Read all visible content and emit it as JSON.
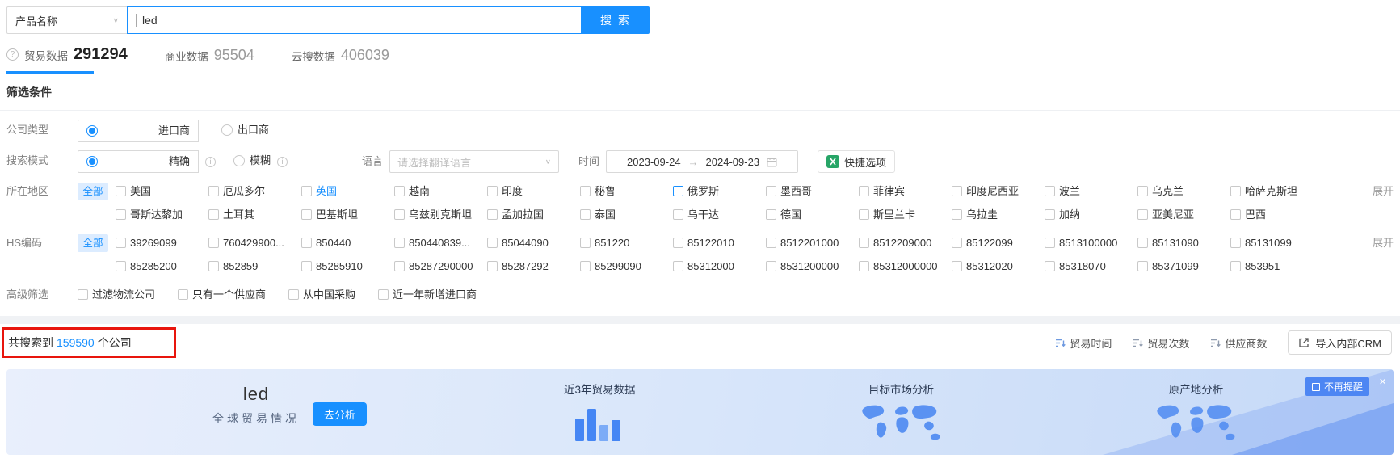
{
  "icons": {
    "chevron_down": "∨",
    "question_mark": "?",
    "info_mark": "i",
    "close": "×",
    "range_arrow": "→"
  },
  "search_bar": {
    "category": "产品名称",
    "query": "led",
    "button": "搜 索"
  },
  "tabs": {
    "trade": {
      "label": "贸易数据",
      "count": "291294"
    },
    "business": {
      "label": "商业数据",
      "count": "95504"
    },
    "cloud": {
      "label": "云搜数据",
      "count": "406039"
    }
  },
  "filters": {
    "title": "筛选条件",
    "company_type": {
      "label": "公司类型",
      "importer": "进口商",
      "exporter": "出口商",
      "selected": "进口商"
    },
    "search_mode": {
      "label": "搜索模式",
      "exact": "精确",
      "fuzzy": "模糊",
      "selected": "精确"
    },
    "language": {
      "label": "语言",
      "placeholder": "请选择翻译语言"
    },
    "time": {
      "label": "时间",
      "start": "2023-09-24",
      "end": "2024-09-23"
    },
    "quick_option": "快捷选项",
    "region": {
      "label": "所在地区",
      "all": "全部",
      "expand": "展开",
      "row1": [
        "美国",
        "厄瓜多尔",
        "英国",
        "越南",
        "印度",
        "秘鲁",
        "俄罗斯",
        "墨西哥",
        "菲律宾",
        "印度尼西亚",
        "波兰",
        "乌克兰",
        "哈萨克斯坦"
      ],
      "row2": [
        "哥斯达黎加",
        "土耳其",
        "巴基斯坦",
        "乌兹别克斯坦",
        "孟加拉国",
        "泰国",
        "乌干达",
        "德国",
        "斯里兰卡",
        "乌拉圭",
        "加纳",
        "亚美尼亚",
        "巴西"
      ]
    },
    "hs_code": {
      "label": "HS编码",
      "all": "全部",
      "expand": "展开",
      "row1": [
        "39269099",
        "760429900...",
        "850440",
        "850440839...",
        "85044090",
        "851220",
        "85122010",
        "8512201000",
        "8512209000",
        "85122099",
        "8513100000",
        "85131090",
        "85131099"
      ],
      "row2": [
        "85285200",
        "852859",
        "85285910",
        "85287290000",
        "85287292",
        "85299090",
        "85312000",
        "8531200000",
        "85312000000",
        "85312020",
        "85318070",
        "85371099",
        "853951"
      ]
    },
    "advanced": {
      "label": "高级筛选",
      "options": [
        "过滤物流公司",
        "只有一个供应商",
        "从中国采购",
        "近一年新增进口商"
      ]
    }
  },
  "results": {
    "prefix": "共搜索到",
    "count": "159590",
    "suffix": "个公司",
    "sort_trade_time": "贸易时间",
    "sort_trade_count": "贸易次数",
    "sort_supplier_count": "供应商数",
    "crm_button": "导入内部CRM"
  },
  "banner": {
    "keyword": "led",
    "subtitle": "全球贸易情况",
    "analyze_button": "去分析",
    "card_trade": "近3年贸易数据",
    "card_market": "目标市场分析",
    "card_origin": "原产地分析",
    "dismiss": "不再提醒"
  }
}
